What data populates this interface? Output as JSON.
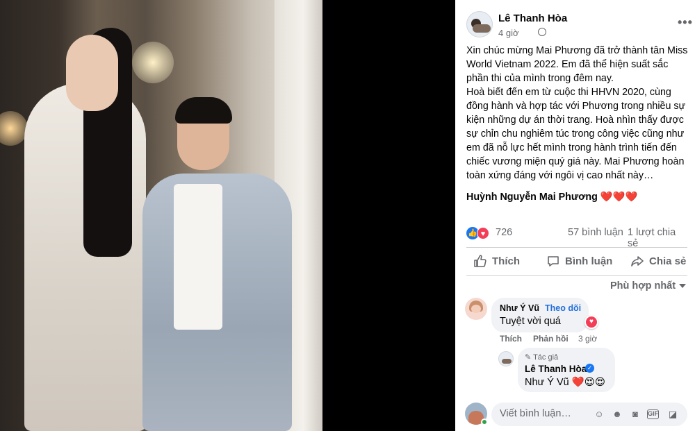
{
  "post": {
    "author": "Lê Thanh Hòa",
    "time": "4 giờ",
    "body": "Xin chúc mừng Mai Phương đã trở thành tân Miss\nWorld Vietnam 2022. Em đã thể hiện suất sắc\nphần thi của mình trong đêm nay.\nHoà biết đến em từ cuộc thi HHVN 2020, cùng\nđồng hành và hợp tác với Phương trong nhiều sự\nkiện những dự án thời trang. Hoà nhìn thấy được\nsự chỉn chu nghiêm túc trong công việc cũng như\nem đã nỗ lực hết mình trong hành trình tiến đến\nchiếc vương miện quý giá này. Mai Phương hoàn\ntoàn xứng đáng với ngôi vị cao nhất này…",
    "tag": "Huỳnh Nguyễn Mai Phương",
    "tag_hearts": "❤️❤️❤️"
  },
  "stats": {
    "reactions": "726",
    "comments": "57 bình luận",
    "shares": "1 lượt chia sẻ"
  },
  "actions": {
    "like": "Thích",
    "comment": "Bình luận",
    "share": "Chia sẻ"
  },
  "sort": "Phù hợp nhất",
  "comments": [
    {
      "name": "Như Ý Vũ",
      "follow": "Theo dõi",
      "text": "Tuyệt vời quá",
      "like": "Thích",
      "reply": "Phản hồi",
      "time": "3 giờ"
    },
    {
      "role": "Tác giả",
      "name": "Lê Thanh Hòa",
      "text": "Như Ý Vũ ❤️😍😍"
    }
  ],
  "composer": {
    "placeholder": "Viết bình luận…"
  },
  "colors": {
    "accent": "#1877f2",
    "heart": "#f33e58",
    "muted": "#65676b"
  }
}
